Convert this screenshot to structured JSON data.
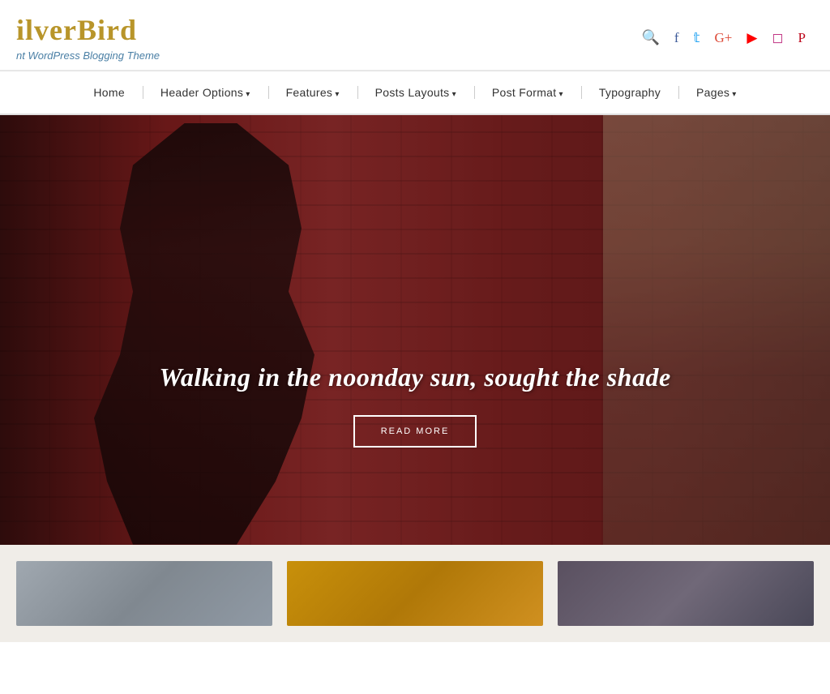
{
  "site": {
    "title": "ilverBird",
    "tagline": "nt WordPress Blogging Theme"
  },
  "header_icons": [
    {
      "name": "search-icon",
      "symbol": "🔍",
      "class": "search"
    },
    {
      "name": "facebook-icon",
      "symbol": "f",
      "class": "facebook"
    },
    {
      "name": "twitter-icon",
      "symbol": "t",
      "class": "twitter"
    },
    {
      "name": "google-icon",
      "symbol": "G+",
      "class": "google"
    },
    {
      "name": "youtube-icon",
      "symbol": "▶",
      "class": "youtube"
    },
    {
      "name": "instagram-icon",
      "symbol": "◻",
      "class": "instagram"
    },
    {
      "name": "pinterest-icon",
      "symbol": "P",
      "class": "pinterest"
    }
  ],
  "nav": {
    "items": [
      {
        "label": "Home",
        "has_dropdown": false
      },
      {
        "label": "Header Options",
        "has_dropdown": true
      },
      {
        "label": "Features",
        "has_dropdown": true
      },
      {
        "label": "Posts Layouts",
        "has_dropdown": true
      },
      {
        "label": "Post Format",
        "has_dropdown": true
      },
      {
        "label": "Typography",
        "has_dropdown": false
      },
      {
        "label": "Pages",
        "has_dropdown": true
      }
    ]
  },
  "hero": {
    "title": "Walking in the noonday sun, sought the shade",
    "button_label": "READ MORE"
  },
  "cards": [
    {
      "id": "card-1"
    },
    {
      "id": "card-2"
    },
    {
      "id": "card-3"
    }
  ]
}
